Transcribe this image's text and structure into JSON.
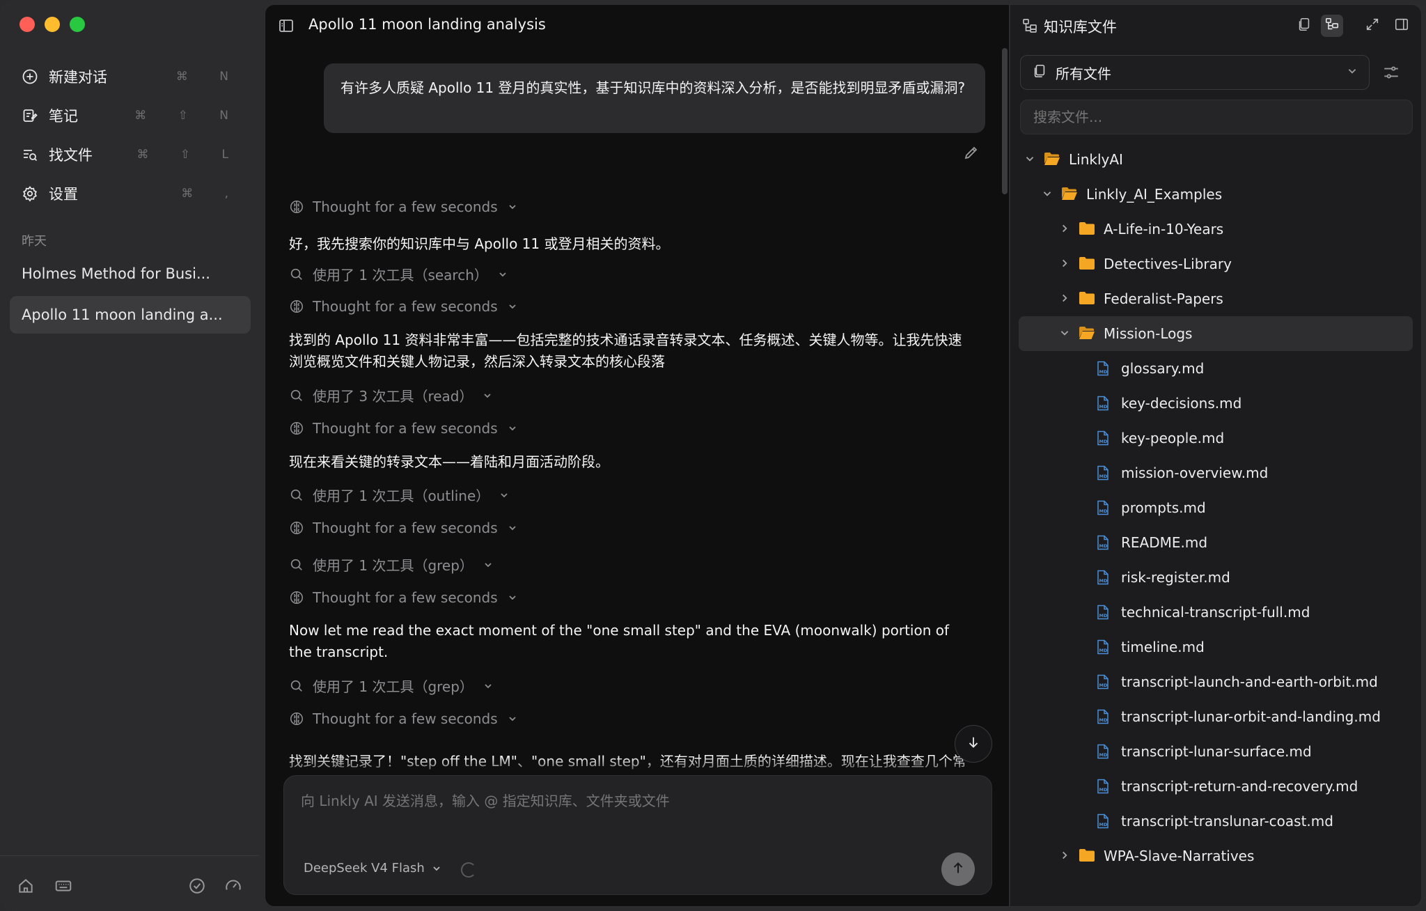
{
  "sidebar": {
    "nav": [
      {
        "label": "新建对话",
        "shortcut": "⌘ N",
        "icon": "new-chat-icon"
      },
      {
        "label": "笔记",
        "shortcut": "⌘ ⇧ N",
        "icon": "notes-icon"
      },
      {
        "label": "找文件",
        "shortcut": "⌘ ⇧ L",
        "icon": "find-file-icon"
      },
      {
        "label": "设置",
        "shortcut": "⌘ ,",
        "icon": "gear-icon"
      }
    ],
    "section_label": "昨天",
    "history": [
      {
        "title": "Holmes Method for Busi...",
        "active": false
      },
      {
        "title": "Apollo 11 moon landing a...",
        "active": true
      }
    ]
  },
  "chat": {
    "title": "Apollo 11 moon landing analysis",
    "user_message": "有许多人质疑 Apollo 11 登月的真实性，基于知识库中的资料深入分析，是否能找到明显矛盾或漏洞?",
    "thought_label": "Thought for a few seconds",
    "msg1": "好，我先搜索你的知识库中与 Apollo 11 或登月相关的资料。",
    "tool1": "使用了 1 次工具（search）",
    "msg2": "找到的 Apollo 11 资料非常丰富——包括完整的技术通话录音转录文本、任务概述、关键人物等。让我先快速浏览概览文件和关键人物记录，然后深入转录文本的核心段落",
    "tool2": "使用了 3 次工具（read）",
    "msg3": "现在来看关键的转录文本——着陆和月面活动阶段。",
    "tool3": "使用了 1 次工具（outline）",
    "tool4": "使用了 1 次工具（grep）",
    "msg4": "Now let me read the exact moment of the \"one small step\" and the EVA (moonwalk) portion of the transcript.",
    "tool5": "使用了 1 次工具（grep）",
    "msg5": "找到关键记录了！\"step off the LM\"、\"one small step\"，还有对月面土质的详细描述。现在让我查查几个常被质疑的细节：旗帜、相机位置和通讯延迟，结果",
    "composer_placeholder": "向 Linkly AI 发送消息，输入 @ 指定知识库、文件夹或文件",
    "model": "DeepSeek V4 Flash"
  },
  "files": {
    "title": "知识库文件",
    "filter": "所有文件",
    "search_placeholder": "搜索文件...",
    "tree": [
      {
        "name": "LinklyAI",
        "type": "folder",
        "depth": 0,
        "open": true
      },
      {
        "name": "Linkly_AI_Examples",
        "type": "folder",
        "depth": 1,
        "open": true
      },
      {
        "name": "A-Life-in-10-Years",
        "type": "folder",
        "depth": 2,
        "open": false
      },
      {
        "name": "Detectives-Library",
        "type": "folder",
        "depth": 2,
        "open": false
      },
      {
        "name": "Federalist-Papers",
        "type": "folder",
        "depth": 2,
        "open": false
      },
      {
        "name": "Mission-Logs",
        "type": "folder",
        "depth": 2,
        "open": true,
        "selected": true
      },
      {
        "name": "glossary.md",
        "type": "file",
        "depth": 3
      },
      {
        "name": "key-decisions.md",
        "type": "file",
        "depth": 3
      },
      {
        "name": "key-people.md",
        "type": "file",
        "depth": 3
      },
      {
        "name": "mission-overview.md",
        "type": "file",
        "depth": 3
      },
      {
        "name": "prompts.md",
        "type": "file",
        "depth": 3
      },
      {
        "name": "README.md",
        "type": "file",
        "depth": 3
      },
      {
        "name": "risk-register.md",
        "type": "file",
        "depth": 3
      },
      {
        "name": "technical-transcript-full.md",
        "type": "file",
        "depth": 3
      },
      {
        "name": "timeline.md",
        "type": "file",
        "depth": 3
      },
      {
        "name": "transcript-launch-and-earth-orbit.md",
        "type": "file",
        "depth": 3
      },
      {
        "name": "transcript-lunar-orbit-and-landing.md",
        "type": "file",
        "depth": 3
      },
      {
        "name": "transcript-lunar-surface.md",
        "type": "file",
        "depth": 3
      },
      {
        "name": "transcript-return-and-recovery.md",
        "type": "file",
        "depth": 3
      },
      {
        "name": "transcript-translunar-coast.md",
        "type": "file",
        "depth": 3
      },
      {
        "name": "WPA-Slave-Narratives",
        "type": "folder",
        "depth": 2,
        "open": false
      }
    ]
  },
  "colors": {
    "folder": "#f5a623",
    "file": "#4a90d9",
    "accent_bg": "#0f0f10"
  }
}
